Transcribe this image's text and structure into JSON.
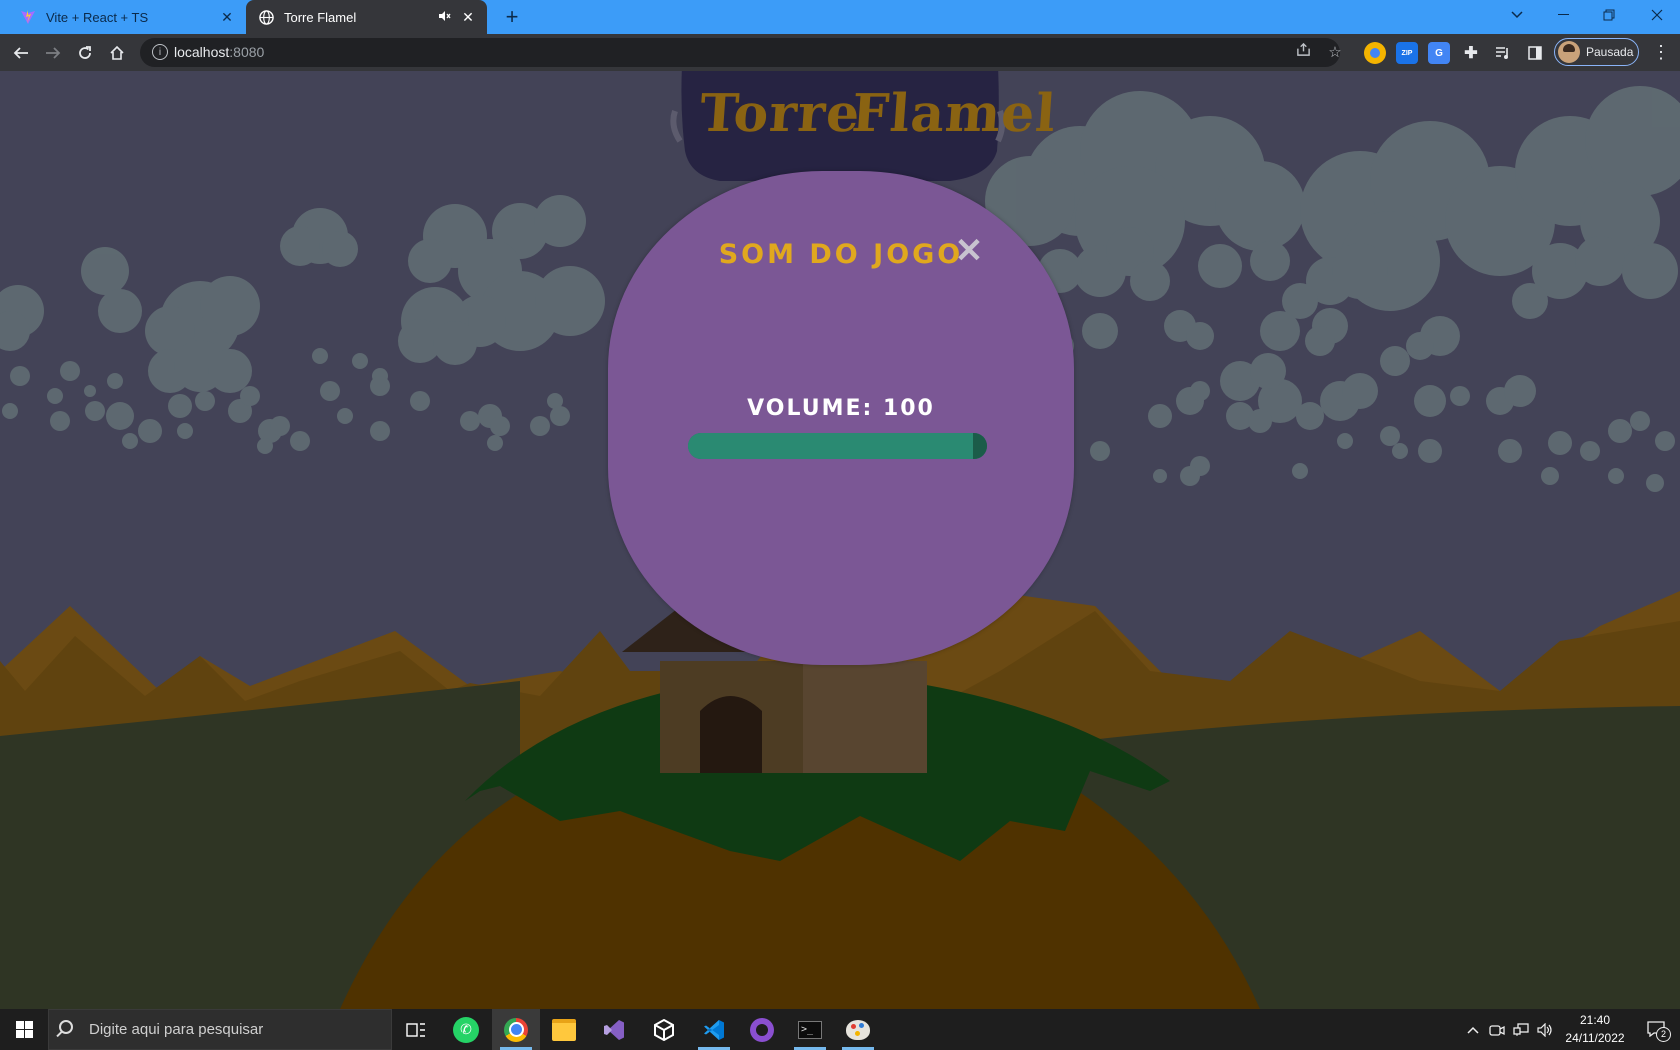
{
  "browser": {
    "tabs": [
      {
        "title": "Vite + React + TS",
        "icon": "vite-icon",
        "active": false
      },
      {
        "title": "Torre Flamel",
        "icon": "globe-icon",
        "active": true
      }
    ],
    "url_host": "localhost",
    "url_port": ":8080",
    "profile_label": "Pausada"
  },
  "game": {
    "logo_text": [
      "Torre",
      "Flamel"
    ],
    "panel_title": "SOM DO JOGO",
    "close_icon": "close-icon",
    "volume_label": "VOLUME: 100",
    "volume_value": 100,
    "volume_max": 100
  },
  "taskbar": {
    "search_placeholder": "Digite aqui para pesquisar",
    "time": "21:40",
    "date": "24/11/2022",
    "notification_count": "2"
  },
  "colors": {
    "tabbar": "#3c9cf8",
    "toolbar": "#35363a",
    "sky": "#434357",
    "panel": "#7b5795",
    "title_gold": "#e0a81e",
    "slider": "#2a8a72"
  }
}
